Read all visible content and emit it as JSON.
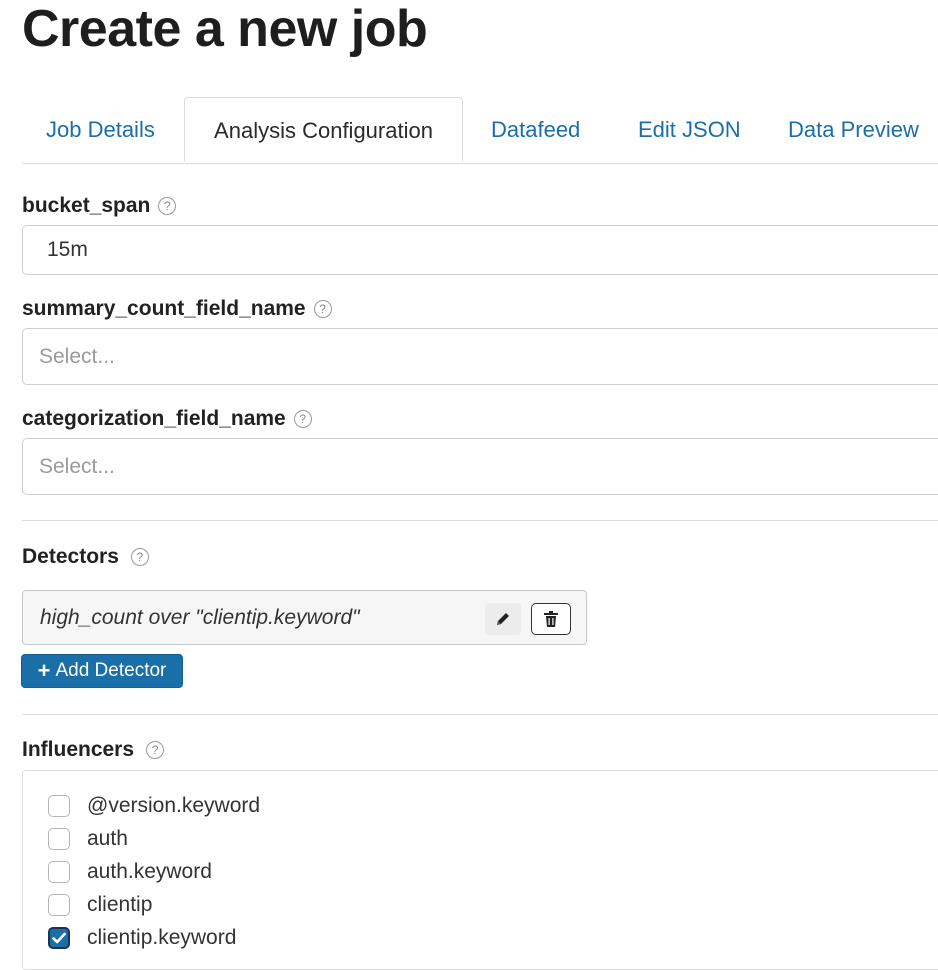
{
  "page_title": "Create a new job",
  "tabs": [
    {
      "label": "Job Details",
      "active": false
    },
    {
      "label": "Analysis Configuration",
      "active": true
    },
    {
      "label": "Datafeed",
      "active": false
    },
    {
      "label": "Edit JSON",
      "active": false
    },
    {
      "label": "Data Preview",
      "active": false
    }
  ],
  "fields": {
    "bucket_span": {
      "label": "bucket_span",
      "value": "15m"
    },
    "summary_count": {
      "label": "summary_count_field_name",
      "placeholder": "Select..."
    },
    "categorization": {
      "label": "categorization_field_name",
      "placeholder": "Select..."
    }
  },
  "help_glyph": "?",
  "detectors": {
    "label": "Detectors",
    "items": [
      {
        "text": "high_count over \"clientip.keyword\""
      }
    ],
    "add_button_label": "Add Detector",
    "add_button_plus": "+"
  },
  "influencers": {
    "label": "Influencers",
    "items": [
      {
        "label": "@version.keyword",
        "checked": false
      },
      {
        "label": "auth",
        "checked": false
      },
      {
        "label": "auth.keyword",
        "checked": false
      },
      {
        "label": "clientip",
        "checked": false
      },
      {
        "label": "clientip.keyword",
        "checked": true
      }
    ]
  },
  "colors": {
    "accent": "#1a6fa8",
    "title": "#1e1e1e",
    "placeholder": "#9a9a9a"
  },
  "icons": {
    "edit": "pencil-icon",
    "delete": "trash-icon",
    "help": "question-circle-icon",
    "check": "checkmark-icon"
  }
}
